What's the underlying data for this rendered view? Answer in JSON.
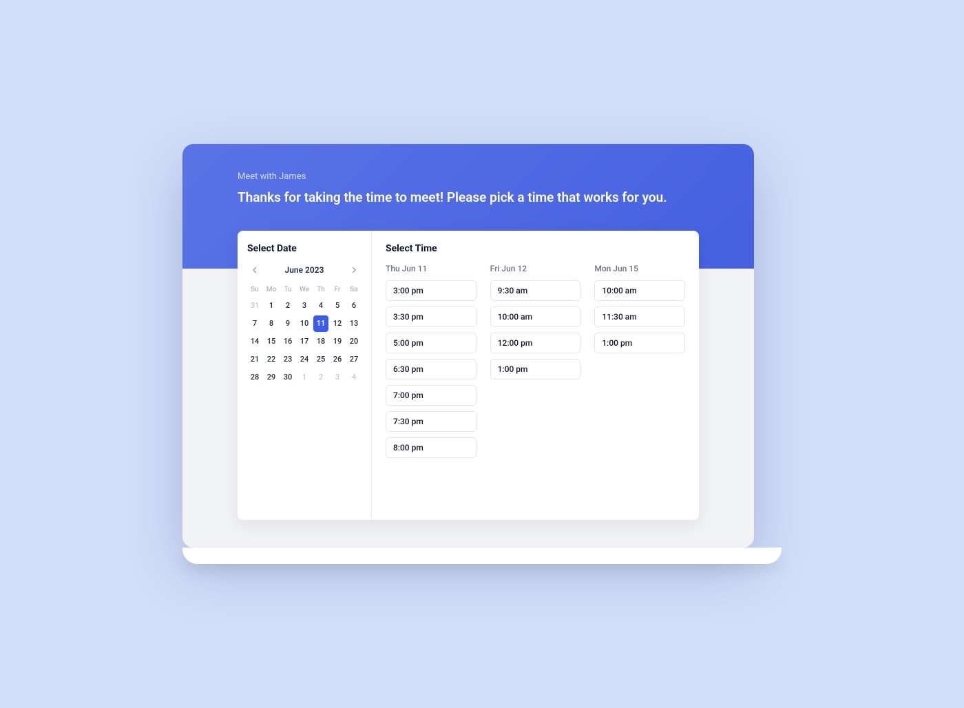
{
  "header": {
    "eyebrow": "Meet with James",
    "title": "Thanks for taking the time to meet! Please pick a time that works for you."
  },
  "date_panel": {
    "title": "Select Date",
    "month_label": "June 2023",
    "weekdays": [
      "Su",
      "Mo",
      "Tu",
      "We",
      "Th",
      "Fr",
      "Sa"
    ],
    "days": [
      {
        "n": "31",
        "muted": true
      },
      {
        "n": "1"
      },
      {
        "n": "2"
      },
      {
        "n": "3"
      },
      {
        "n": "4"
      },
      {
        "n": "5"
      },
      {
        "n": "6"
      },
      {
        "n": "7"
      },
      {
        "n": "8"
      },
      {
        "n": "9"
      },
      {
        "n": "10"
      },
      {
        "n": "11",
        "selected": true
      },
      {
        "n": "12"
      },
      {
        "n": "13"
      },
      {
        "n": "14"
      },
      {
        "n": "15"
      },
      {
        "n": "16"
      },
      {
        "n": "17"
      },
      {
        "n": "18"
      },
      {
        "n": "19"
      },
      {
        "n": "20"
      },
      {
        "n": "21"
      },
      {
        "n": "22"
      },
      {
        "n": "23"
      },
      {
        "n": "24"
      },
      {
        "n": "25"
      },
      {
        "n": "26"
      },
      {
        "n": "27"
      },
      {
        "n": "28"
      },
      {
        "n": "29"
      },
      {
        "n": "30"
      },
      {
        "n": "1",
        "muted": true
      },
      {
        "n": "2",
        "muted": true
      },
      {
        "n": "3",
        "muted": true
      },
      {
        "n": "4",
        "muted": true
      }
    ]
  },
  "time_panel": {
    "title": "Select Time",
    "columns": [
      {
        "label": "Thu Jun 11",
        "slots": [
          "3:00 pm",
          "3:30 pm",
          "5:00 pm",
          "6:30 pm",
          "7:00 pm",
          "7:30 pm",
          "8:00 pm"
        ]
      },
      {
        "label": "Fri Jun 12",
        "slots": [
          "9:30 am",
          "10:00 am",
          "12:00 pm",
          "1:00 pm"
        ]
      },
      {
        "label": "Mon Jun 15",
        "slots": [
          "10:00 am",
          "11:30 am",
          "1:00 pm"
        ]
      }
    ]
  }
}
